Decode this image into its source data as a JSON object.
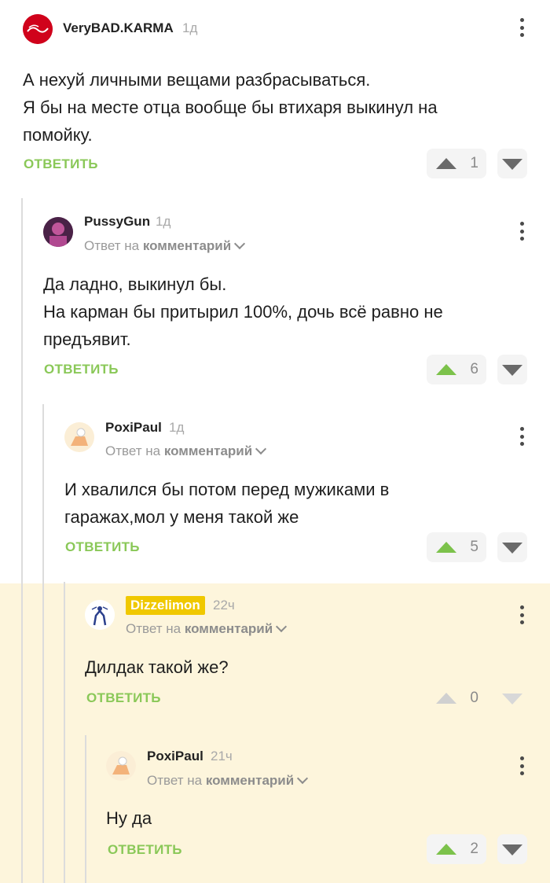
{
  "reply_label": "ОТВЕТИТЬ",
  "reply_to_prefix": "Ответ на",
  "reply_to_link": "комментарий",
  "comments": [
    {
      "username": "VeryBAD.KARMA",
      "time": "1д",
      "lines": [
        "А нехуй личными вещами разбрасываться.",
        "Я бы на месте отца вообще бы втихаря выкинул на",
        "помойку."
      ],
      "votes": "1"
    },
    {
      "username": "PussyGun",
      "time": "1д",
      "lines": [
        "Да ладно, выкинул бы.",
        "На карман бы притырил 100%, дочь всё равно не",
        "предъявит."
      ],
      "votes": "6"
    },
    {
      "username": "PoxiPaul",
      "time": "1д",
      "lines": [
        "И хвалился бы потом перед мужиками в",
        "гаражах,мол у меня такой же"
      ],
      "votes": "5"
    },
    {
      "username": "Dizzelimon",
      "time": "22ч",
      "lines": [
        "Дилдак такой же?"
      ],
      "votes": "0"
    },
    {
      "username": "PoxiPaul",
      "time": "21ч",
      "lines": [
        "Ну да"
      ],
      "votes": "2"
    }
  ],
  "colors": {
    "accent_green": "#7cc24b",
    "reply_green": "#8ac858",
    "highlight_bg": "#fdf5dc",
    "badge_yellow": "#f0c800"
  }
}
